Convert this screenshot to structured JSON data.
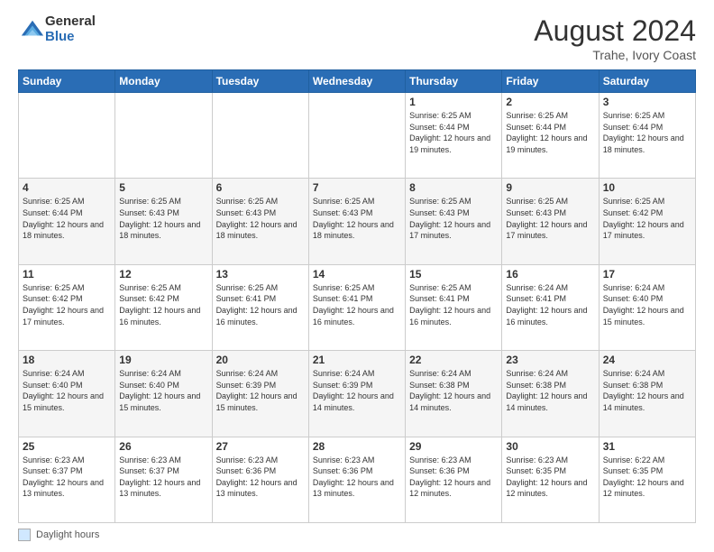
{
  "logo": {
    "general": "General",
    "blue": "Blue"
  },
  "header": {
    "month_year": "August 2024",
    "location": "Trahe, Ivory Coast"
  },
  "days_of_week": [
    "Sunday",
    "Monday",
    "Tuesday",
    "Wednesday",
    "Thursday",
    "Friday",
    "Saturday"
  ],
  "weeks": [
    [
      {
        "day": "",
        "info": ""
      },
      {
        "day": "",
        "info": ""
      },
      {
        "day": "",
        "info": ""
      },
      {
        "day": "",
        "info": ""
      },
      {
        "day": "1",
        "info": "Sunrise: 6:25 AM\nSunset: 6:44 PM\nDaylight: 12 hours\nand 19 minutes."
      },
      {
        "day": "2",
        "info": "Sunrise: 6:25 AM\nSunset: 6:44 PM\nDaylight: 12 hours\nand 19 minutes."
      },
      {
        "day": "3",
        "info": "Sunrise: 6:25 AM\nSunset: 6:44 PM\nDaylight: 12 hours\nand 18 minutes."
      }
    ],
    [
      {
        "day": "4",
        "info": "Sunrise: 6:25 AM\nSunset: 6:44 PM\nDaylight: 12 hours\nand 18 minutes."
      },
      {
        "day": "5",
        "info": "Sunrise: 6:25 AM\nSunset: 6:43 PM\nDaylight: 12 hours\nand 18 minutes."
      },
      {
        "day": "6",
        "info": "Sunrise: 6:25 AM\nSunset: 6:43 PM\nDaylight: 12 hours\nand 18 minutes."
      },
      {
        "day": "7",
        "info": "Sunrise: 6:25 AM\nSunset: 6:43 PM\nDaylight: 12 hours\nand 18 minutes."
      },
      {
        "day": "8",
        "info": "Sunrise: 6:25 AM\nSunset: 6:43 PM\nDaylight: 12 hours\nand 17 minutes."
      },
      {
        "day": "9",
        "info": "Sunrise: 6:25 AM\nSunset: 6:43 PM\nDaylight: 12 hours\nand 17 minutes."
      },
      {
        "day": "10",
        "info": "Sunrise: 6:25 AM\nSunset: 6:42 PM\nDaylight: 12 hours\nand 17 minutes."
      }
    ],
    [
      {
        "day": "11",
        "info": "Sunrise: 6:25 AM\nSunset: 6:42 PM\nDaylight: 12 hours\nand 17 minutes."
      },
      {
        "day": "12",
        "info": "Sunrise: 6:25 AM\nSunset: 6:42 PM\nDaylight: 12 hours\nand 16 minutes."
      },
      {
        "day": "13",
        "info": "Sunrise: 6:25 AM\nSunset: 6:41 PM\nDaylight: 12 hours\nand 16 minutes."
      },
      {
        "day": "14",
        "info": "Sunrise: 6:25 AM\nSunset: 6:41 PM\nDaylight: 12 hours\nand 16 minutes."
      },
      {
        "day": "15",
        "info": "Sunrise: 6:25 AM\nSunset: 6:41 PM\nDaylight: 12 hours\nand 16 minutes."
      },
      {
        "day": "16",
        "info": "Sunrise: 6:24 AM\nSunset: 6:41 PM\nDaylight: 12 hours\nand 16 minutes."
      },
      {
        "day": "17",
        "info": "Sunrise: 6:24 AM\nSunset: 6:40 PM\nDaylight: 12 hours\nand 15 minutes."
      }
    ],
    [
      {
        "day": "18",
        "info": "Sunrise: 6:24 AM\nSunset: 6:40 PM\nDaylight: 12 hours\nand 15 minutes."
      },
      {
        "day": "19",
        "info": "Sunrise: 6:24 AM\nSunset: 6:40 PM\nDaylight: 12 hours\nand 15 minutes."
      },
      {
        "day": "20",
        "info": "Sunrise: 6:24 AM\nSunset: 6:39 PM\nDaylight: 12 hours\nand 15 minutes."
      },
      {
        "day": "21",
        "info": "Sunrise: 6:24 AM\nSunset: 6:39 PM\nDaylight: 12 hours\nand 14 minutes."
      },
      {
        "day": "22",
        "info": "Sunrise: 6:24 AM\nSunset: 6:38 PM\nDaylight: 12 hours\nand 14 minutes."
      },
      {
        "day": "23",
        "info": "Sunrise: 6:24 AM\nSunset: 6:38 PM\nDaylight: 12 hours\nand 14 minutes."
      },
      {
        "day": "24",
        "info": "Sunrise: 6:24 AM\nSunset: 6:38 PM\nDaylight: 12 hours\nand 14 minutes."
      }
    ],
    [
      {
        "day": "25",
        "info": "Sunrise: 6:23 AM\nSunset: 6:37 PM\nDaylight: 12 hours\nand 13 minutes."
      },
      {
        "day": "26",
        "info": "Sunrise: 6:23 AM\nSunset: 6:37 PM\nDaylight: 12 hours\nand 13 minutes."
      },
      {
        "day": "27",
        "info": "Sunrise: 6:23 AM\nSunset: 6:36 PM\nDaylight: 12 hours\nand 13 minutes."
      },
      {
        "day": "28",
        "info": "Sunrise: 6:23 AM\nSunset: 6:36 PM\nDaylight: 12 hours\nand 13 minutes."
      },
      {
        "day": "29",
        "info": "Sunrise: 6:23 AM\nSunset: 6:36 PM\nDaylight: 12 hours\nand 12 minutes."
      },
      {
        "day": "30",
        "info": "Sunrise: 6:23 AM\nSunset: 6:35 PM\nDaylight: 12 hours\nand 12 minutes."
      },
      {
        "day": "31",
        "info": "Sunrise: 6:22 AM\nSunset: 6:35 PM\nDaylight: 12 hours\nand 12 minutes."
      }
    ]
  ],
  "footer": {
    "label": "Daylight hours"
  }
}
